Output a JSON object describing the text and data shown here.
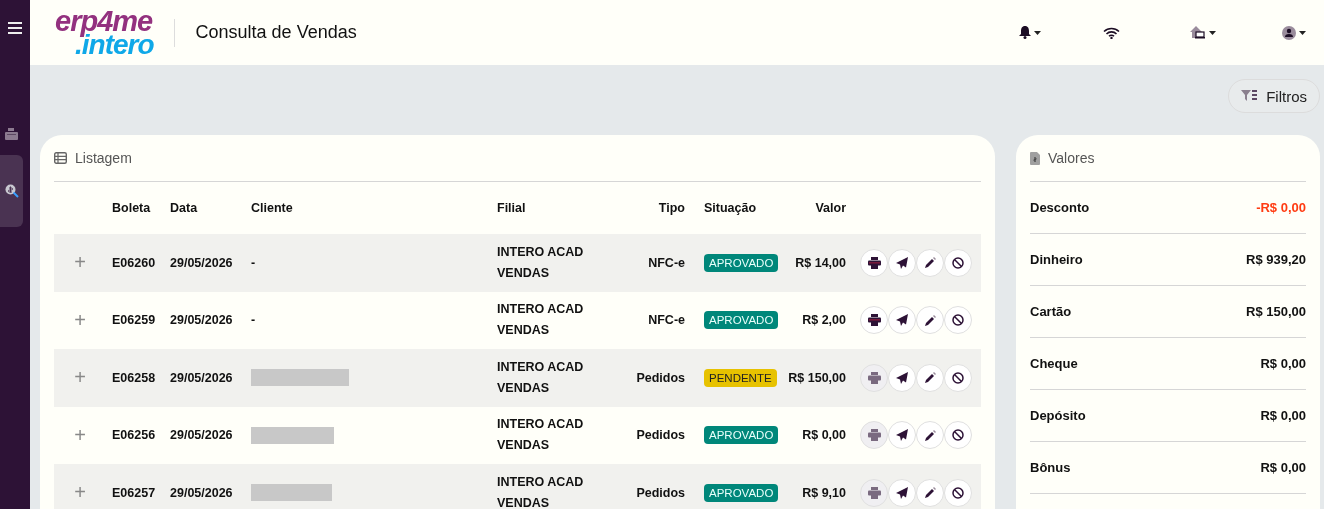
{
  "sidebar": {
    "items": [
      {
        "kind": "register",
        "selected": false
      },
      {
        "kind": "money-search",
        "selected": true
      }
    ]
  },
  "header": {
    "logo_top": "erp4me",
    "logo_bottom": ".intero",
    "title": "Consulta de Vendas"
  },
  "toolbar": {
    "filter_button": "Filtros"
  },
  "listing": {
    "title": "Listagem",
    "columns": [
      "Boleta",
      "Data",
      "Cliente",
      "Filial",
      "Tipo",
      "Situação",
      "Valor"
    ],
    "rows": [
      {
        "expand": "+",
        "boleta": "E06260",
        "data": "29/05/2026",
        "cliente": "-",
        "redacted": false,
        "filial": "INTERO ACAD VENDAS",
        "tipo": "NFC-e",
        "situacao": "APROVADO",
        "kind": "approved",
        "valor": "R$ 14,00",
        "print_disabled": false
      },
      {
        "expand": "+",
        "boleta": "E06259",
        "data": "29/05/2026",
        "cliente": "-",
        "redacted": false,
        "filial": "INTERO ACAD VENDAS",
        "tipo": "NFC-e",
        "situacao": "APROVADO",
        "kind": "approved",
        "valor": "R$ 2,00",
        "print_disabled": false
      },
      {
        "expand": "+",
        "boleta": "E06258",
        "data": "29/05/2026",
        "redacted": true,
        "filial": "INTERO ACAD VENDAS",
        "tipo": "Pedidos",
        "situacao": "PENDENTE",
        "kind": "pending",
        "valor": "R$ 150,00",
        "print_disabled": true
      },
      {
        "expand": "+",
        "boleta": "E06256",
        "data": "29/05/2026",
        "redacted": true,
        "filial": "INTERO ACAD VENDAS",
        "tipo": "Pedidos",
        "situacao": "APROVADO",
        "kind": "approved",
        "valor": "R$ 0,00",
        "print_disabled": true
      },
      {
        "expand": "+",
        "boleta": "E06257",
        "data": "29/05/2026",
        "redacted": true,
        "filial": "INTERO ACAD VENDAS",
        "tipo": "Pedidos",
        "situacao": "APROVADO",
        "kind": "approved",
        "valor": "R$ 9,10",
        "print_disabled": true
      }
    ]
  },
  "values": {
    "title": "Valores",
    "items": [
      {
        "label": "Desconto",
        "value": "-R$ 0,00",
        "negative": true
      },
      {
        "label": "Dinheiro",
        "value": "R$ 939,20",
        "negative": false
      },
      {
        "label": "Cartão",
        "value": "R$ 150,00",
        "negative": false
      },
      {
        "label": "Cheque",
        "value": "R$ 0,00",
        "negative": false
      },
      {
        "label": "Depósito",
        "value": "R$ 0,00",
        "negative": false
      },
      {
        "label": "Bônus",
        "value": "R$ 0,00",
        "negative": false
      }
    ]
  }
}
